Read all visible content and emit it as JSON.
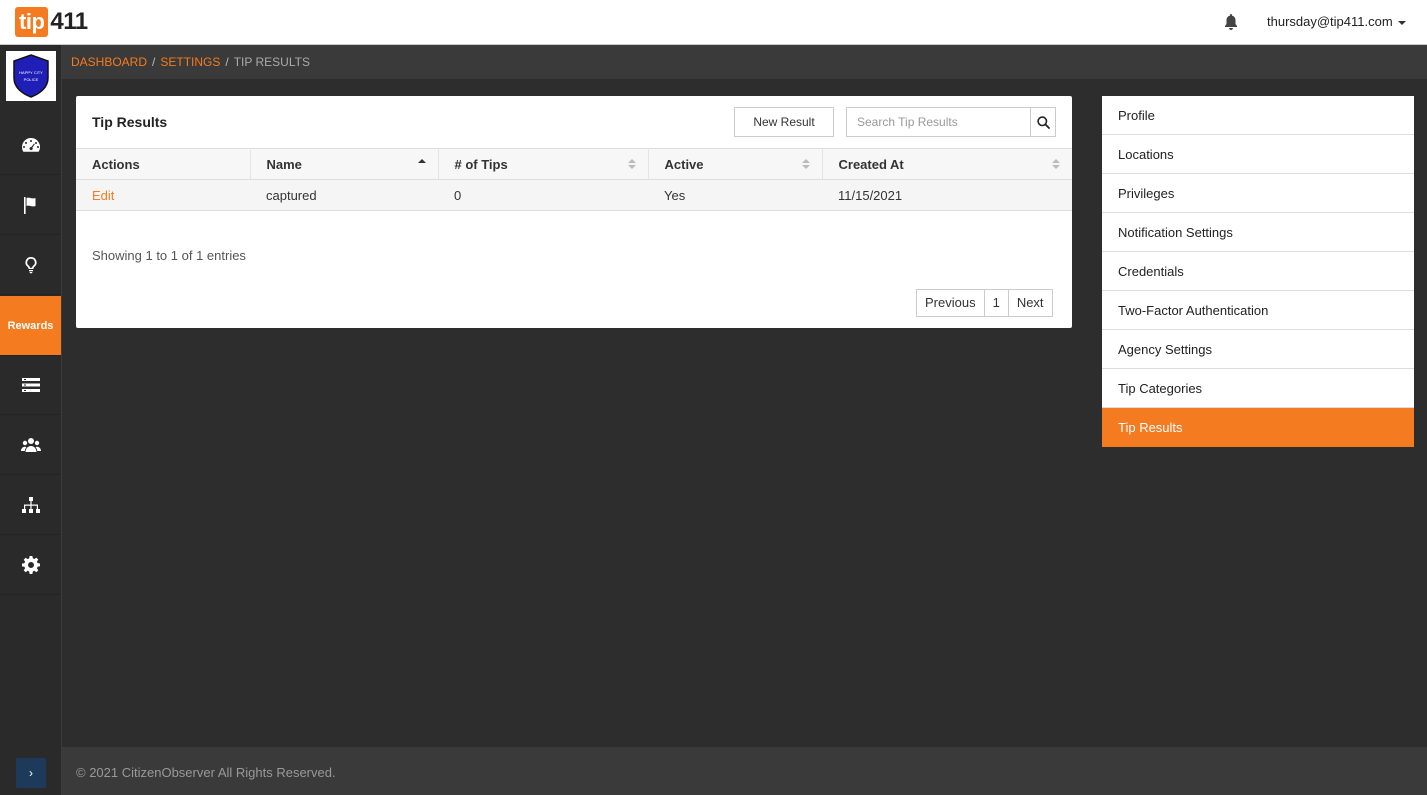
{
  "brand": {
    "logo_part1": "tip",
    "logo_part2": "411"
  },
  "header": {
    "user_email": "thursday@tip411.com"
  },
  "sidebar": {
    "badge_text": "HAPPY CITY POLICE",
    "items": [
      {
        "icon": "dashboard-icon"
      },
      {
        "icon": "flag-icon"
      },
      {
        "icon": "lightbulb-icon"
      },
      {
        "icon": "rewards",
        "label": "Rewards",
        "active": true
      },
      {
        "icon": "list-icon"
      },
      {
        "icon": "users-icon"
      },
      {
        "icon": "sitemap-icon"
      },
      {
        "icon": "gear-icon"
      }
    ],
    "collapse_label": "›"
  },
  "breadcrumb": {
    "item1": "DASHBOARD",
    "item2": "SETTINGS",
    "current": "TIP RESULTS",
    "sep": "/"
  },
  "panel": {
    "title": "Tip Results",
    "new_button": "New Result",
    "search_placeholder": "Search Tip Results",
    "columns": [
      "Actions",
      "Name",
      "# of Tips",
      "Active",
      "Created At"
    ],
    "rows": [
      {
        "action": "Edit",
        "name": "captured",
        "tips": "0",
        "active": "Yes",
        "created": "11/15/2021"
      }
    ],
    "entries_text": "Showing 1 to 1 of 1 entries",
    "pager": {
      "prev": "Previous",
      "page": "1",
      "next": "Next"
    }
  },
  "settings_menu": {
    "items": [
      "Profile",
      "Locations",
      "Privileges",
      "Notification Settings",
      "Credentials",
      "Two-Factor Authentication",
      "Agency Settings",
      "Tip Categories",
      "Tip Results"
    ],
    "active": "Tip Results"
  },
  "footer": {
    "text": "© 2021 CitizenObserver All Rights Reserved."
  },
  "colors": {
    "accent": "#f47b20",
    "dark": "#2d2d2d"
  }
}
